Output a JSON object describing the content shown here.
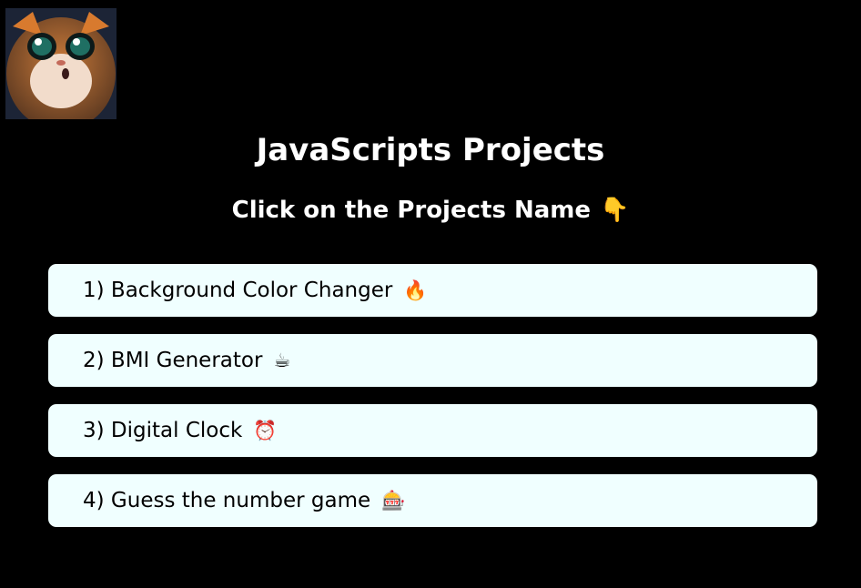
{
  "header": {
    "title": "JavaScripts Projects",
    "subtitle": "Click on the Projects Name",
    "subtitle_emoji": "👇"
  },
  "projects": [
    {
      "label": "1) Background Color Changer",
      "emoji": "🔥"
    },
    {
      "label": "2) BMI Generator",
      "emoji": "☕"
    },
    {
      "label": "3) Digital Clock",
      "emoji": "⏰"
    },
    {
      "label": "4) Guess the number game",
      "emoji": "🎰"
    }
  ],
  "colors": {
    "background": "#000000",
    "card": "#f0ffff",
    "heading_text": "#ffffff",
    "card_text": "#000000"
  }
}
